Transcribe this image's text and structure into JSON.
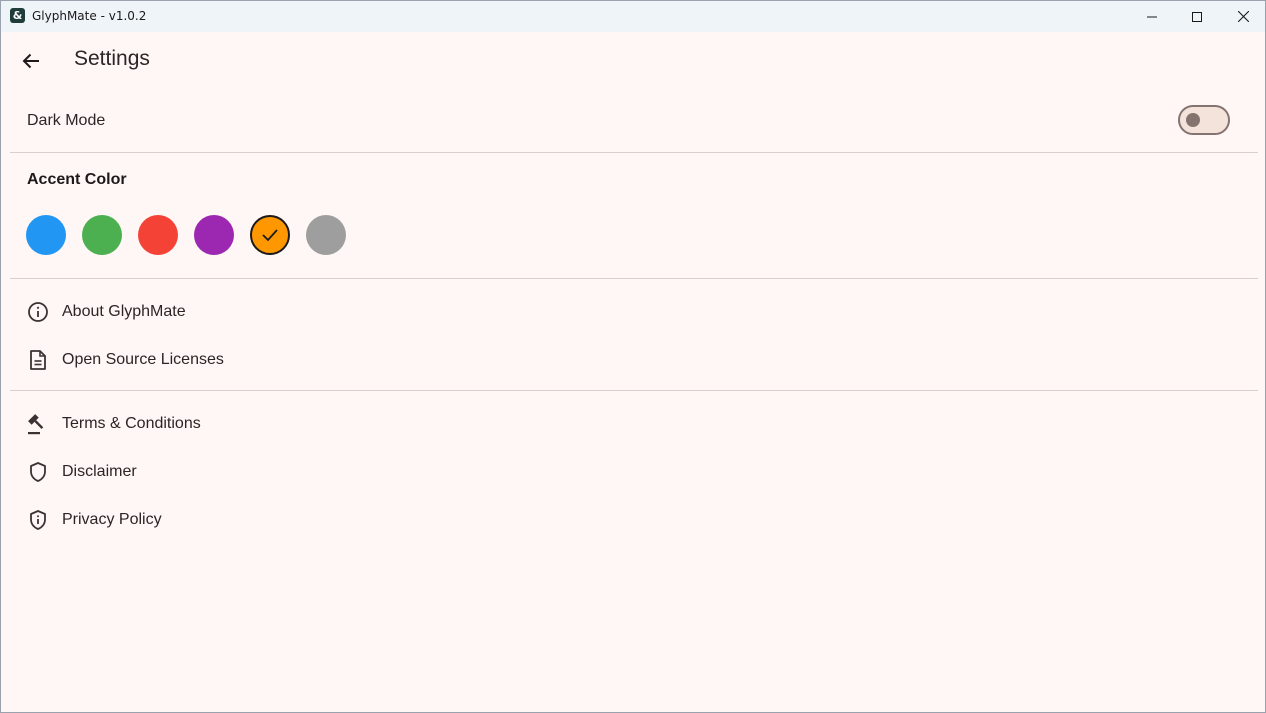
{
  "window": {
    "title": "GlyphMate - v1.0.2",
    "app_icon_glyph": "&",
    "app_icon": "ampersand-app-icon",
    "controls": [
      "minimize-icon",
      "maximize-icon",
      "close-icon"
    ]
  },
  "header": {
    "back_icon": "arrow-left-icon",
    "title": "Settings"
  },
  "dark_mode": {
    "label": "Dark Mode",
    "enabled": false
  },
  "accent": {
    "title": "Accent Color",
    "selected_index": 4,
    "colors": [
      "#2196f3",
      "#4caf50",
      "#f44336",
      "#9c27b0",
      "#ff9800",
      "#9e9e9e"
    ]
  },
  "info_items": [
    {
      "label": "About GlyphMate",
      "icon": "info-icon"
    },
    {
      "label": "Open Source Licenses",
      "icon": "document-icon"
    }
  ],
  "legal_items": [
    {
      "label": "Terms & Conditions",
      "icon": "gavel-icon"
    },
    {
      "label": "Disclaimer",
      "icon": "shield-icon"
    },
    {
      "label": "Privacy Policy",
      "icon": "shield-info-icon"
    }
  ],
  "colors": {
    "background": "#fff7f5",
    "text": "#2b2626",
    "toggle_track": "#f4e3da",
    "toggle_outline": "#857370",
    "divider": "#d9cfcc"
  }
}
